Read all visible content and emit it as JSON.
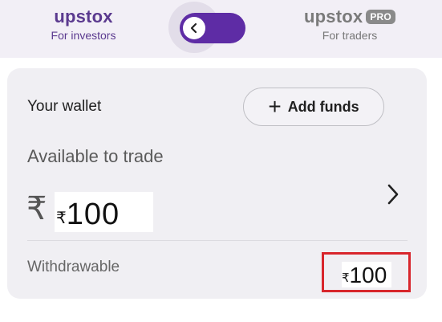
{
  "header": {
    "investors": {
      "logo": "upstox",
      "tagline": "For investors"
    },
    "traders": {
      "logo": "upstox",
      "badge": "PRO",
      "tagline": "For traders"
    },
    "toggle": {
      "icon": "chevron-left-icon",
      "color": "#5e2ca5"
    }
  },
  "wallet": {
    "title": "Your wallet",
    "add_funds_label": "Add funds",
    "available_label": "Available to trade",
    "currency_symbol": "₹",
    "available_symbol": "₹",
    "available_amount": "100",
    "withdrawable_label": "Withdrawable",
    "withdrawable_symbol": "₹",
    "withdrawable_amount": "100",
    "highlight_color": "#d8262c"
  }
}
